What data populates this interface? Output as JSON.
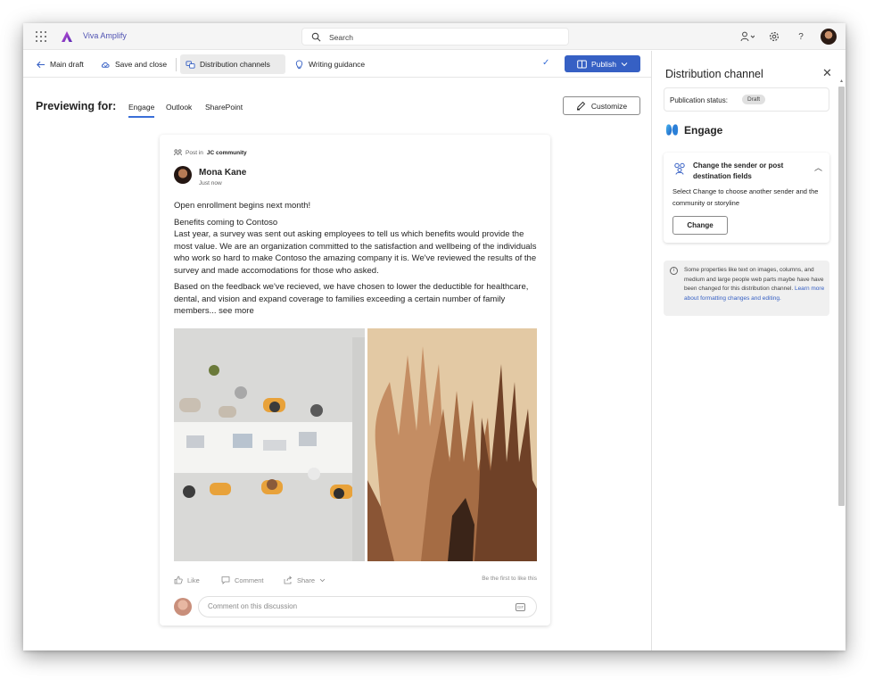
{
  "app": {
    "name": "Viva Amplify"
  },
  "search": {
    "placeholder": "Search"
  },
  "toolbar": {
    "main_draft": "Main draft",
    "save_and_close": "Save and close",
    "distribution_channels": "Distribution channels",
    "writing_guidance": "Writing guidance",
    "publish": "Publish"
  },
  "preview": {
    "label": "Previewing for:",
    "tabs": [
      "Engage",
      "Outlook",
      "SharePoint"
    ],
    "active_tab": "Engage",
    "customize": "Customize"
  },
  "post": {
    "posted_in_prefix": "Post in",
    "community": "JC community",
    "author": "Mona Kane",
    "time": "Just now",
    "headline": "Open enrollment begins next month!",
    "paragraph1": "Benefits coming to Contoso\nLast year, a survey was sent out asking employees to tell us which benefits would provide the most value. We are an organization committed to the satisfaction and wellbeing of the individuals who work so hard to make Contoso the amazing company it is. We've reviewed the results of the survey and made accomodations for those who asked.",
    "paragraph2": "Based on the feedback we've recieved, we have chosen to lower the deductible for healthcare, dental, and vision and expand coverage to families exceeding a certain number of family members... see more",
    "actions": {
      "like": "Like",
      "comment": "Comment",
      "share": "Share",
      "first_like": "Be the first to like this"
    },
    "comment_placeholder": "Comment on this discussion"
  },
  "panel": {
    "title": "Distribution channel",
    "publication_status_label": "Publication status:",
    "publication_status": "Draft",
    "channel": "Engage",
    "change_card": {
      "title": "Change the sender or post destination fields",
      "description": "Select Change to choose another sender and the community or storyline",
      "button": "Change"
    },
    "info": {
      "text": "Some properties like text on images, columns, and medium and large people web parts maybe have have been changed for this distribution channel.",
      "link": "Learn more about formatting changes and editing."
    }
  },
  "colors": {
    "accent": "#3660c4",
    "brand": "#4f52b2",
    "tab_underline": "#3a6fd8"
  },
  "icons": [
    "waffle-icon",
    "viva-amplify-logo",
    "search-icon",
    "person-settings-icon",
    "gear-icon",
    "help-icon",
    "back-arrow-icon",
    "save-cloud-icon",
    "channels-icon",
    "guidance-icon",
    "checkmark-icon",
    "book-icon",
    "chevron-down-icon",
    "pen-icon",
    "community-icon",
    "like-icon",
    "comment-icon",
    "share-icon",
    "gif-icon",
    "close-icon",
    "engage-icon",
    "people-icon",
    "chevron-up-icon",
    "info-icon"
  ]
}
